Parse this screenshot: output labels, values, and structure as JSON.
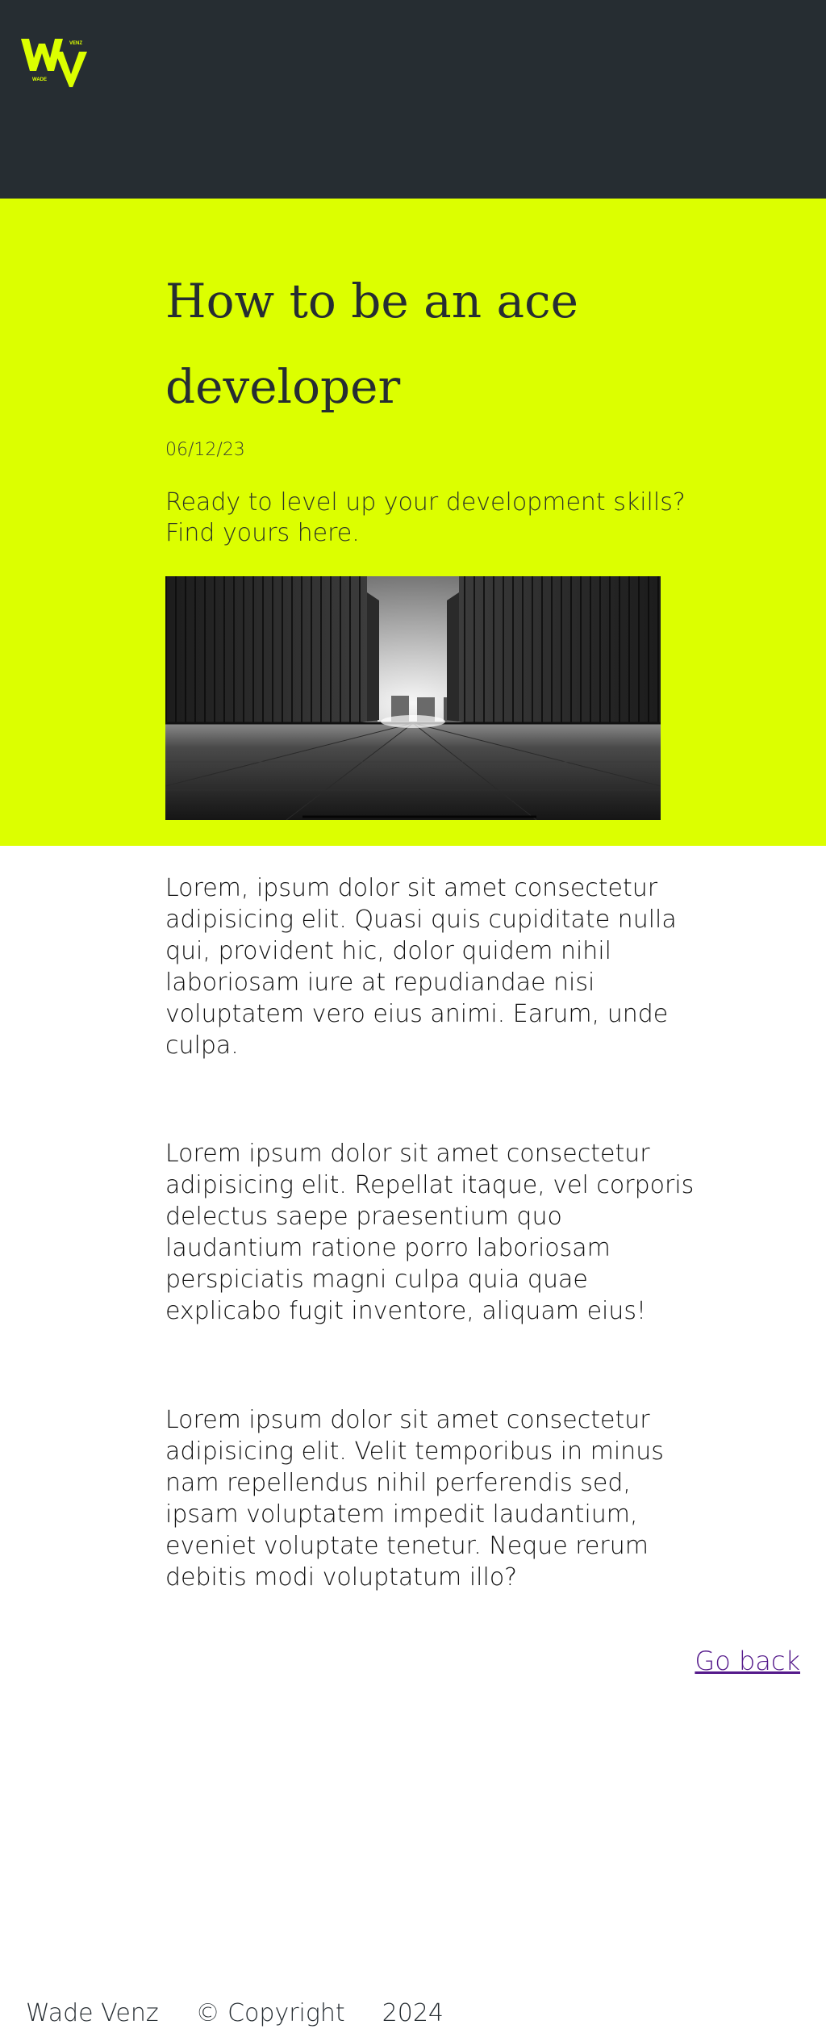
{
  "header": {
    "logo_initials": "WV",
    "logo_small_first": "WADE",
    "logo_small_last": "VENZ",
    "background": "#262d32",
    "accent": "#dcff00"
  },
  "post": {
    "title": "How to be an ace developer",
    "date": "06/12/23",
    "subtitle": "Ready to level up your development skills? Find yours here.",
    "hero_image_alt": "",
    "paragraphs": [
      "Lorem, ipsum dolor sit amet consectetur adipisicing elit. Quasi quis cupiditate nulla qui, provident hic, dolor quidem nihil laboriosam iure at repudiandae nisi voluptatem vero eius animi. Earum, unde culpa.",
      "Lorem ipsum dolor sit amet consectetur adipisicing elit. Repellat itaque, vel corporis delectus saepe praesentium quo laudantium ratione porro laboriosam perspiciatis magni culpa quia quae explicabo fugit inventore, aliquam eius!",
      "Lorem ipsum dolor sit amet consectetur adipisicing elit. Velit temporibus in minus nam repellendus nihil perferendis sed, ipsam voluptatem impedit laudantium, eveniet voluptate tenetur. Neque rerum debitis modi voluptatum illo?"
    ],
    "back_link": "Go back"
  },
  "footer": {
    "name": "Wade Venz",
    "copyright": "© Copyright",
    "year": "2024"
  },
  "colors": {
    "hero_background": "#dcff00",
    "link": "#551a8b"
  }
}
